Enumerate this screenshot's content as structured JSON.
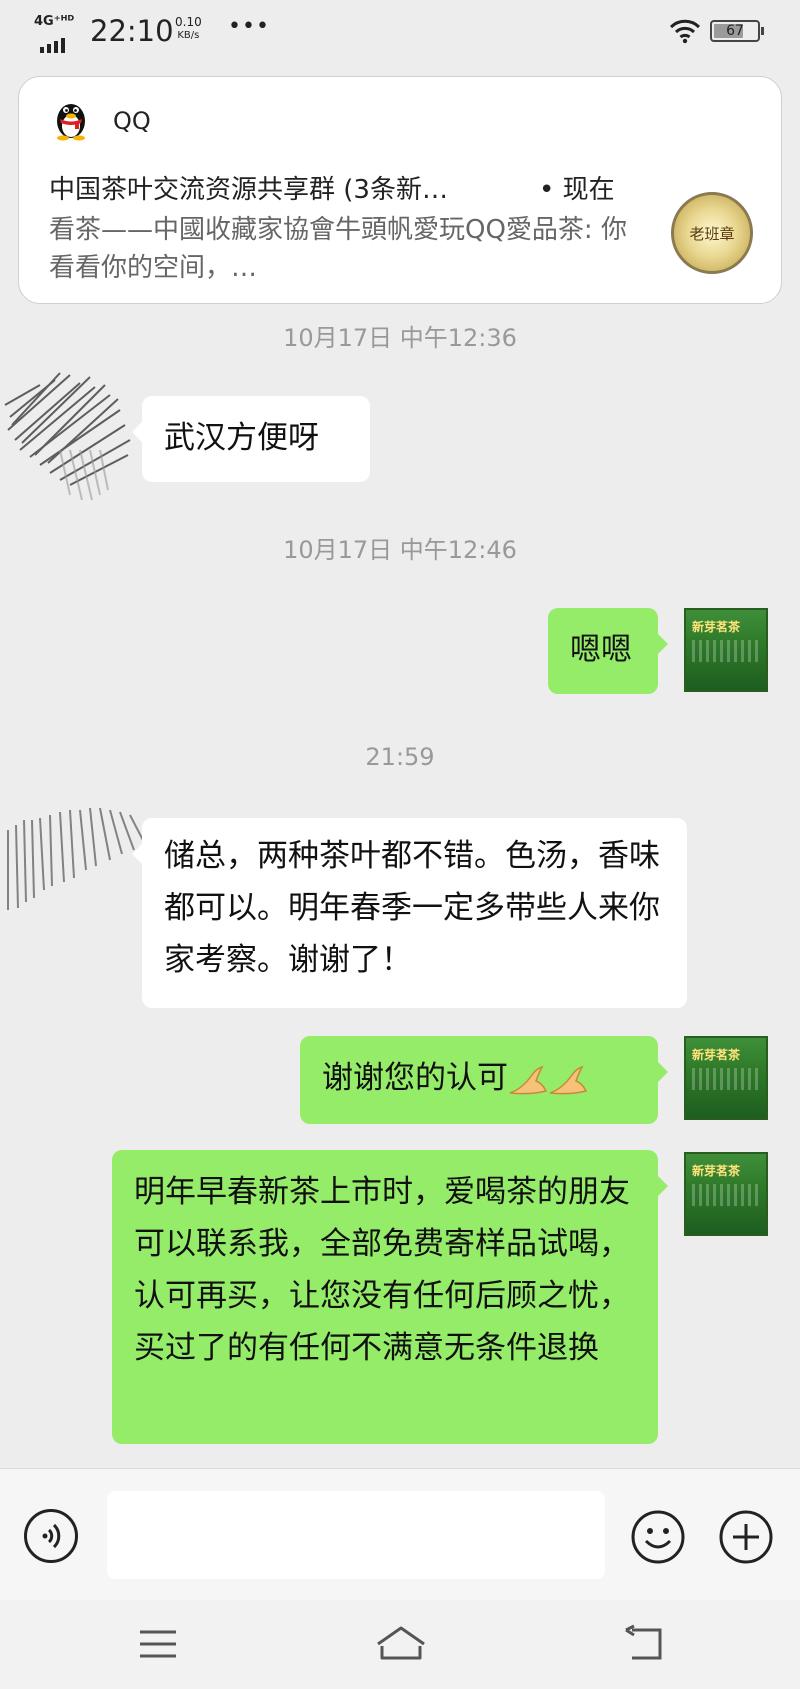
{
  "status_bar": {
    "network": "4G⁺ᴴᴰ",
    "time": "22:10",
    "speed_value": "0.10",
    "speed_unit": "KB/s",
    "more": "•••",
    "battery": "67"
  },
  "notification": {
    "app_name": "QQ",
    "title": "中国茶叶交流资源共享群 (3条新…",
    "time": "• 现在",
    "body": "看茶——中國收藏家協會牛頭帆愛玩QQ愛品茶: 你看看你的空间，…",
    "thumbnail_text": "老班章"
  },
  "chat": {
    "timestamps": [
      "10月17日 中午12:36",
      "10月17日 中午12:46",
      "21:59"
    ],
    "messages": [
      {
        "side": "left",
        "text": "武汉方便呀"
      },
      {
        "side": "right",
        "text": "嗯嗯"
      },
      {
        "side": "left",
        "text": "储总，两种茶叶都不错。色汤，香味都可以。明年春季一定多带些人来你家考察。谢谢了！"
      },
      {
        "side": "right",
        "text": "谢谢您的认可"
      },
      {
        "side": "right",
        "text": "明年早春新茶上市时，爱喝茶的朋友可以联系我，全部免费寄样品试喝，认可再买，让您没有任何后顾之忧，买过了的有任何不满意无条件退换"
      }
    ],
    "self_avatar_label": "新芽茗茶"
  },
  "input_bar": {
    "placeholder": ""
  },
  "colors": {
    "background": "#ededed",
    "self_bubble": "#95ec69",
    "other_bubble": "#ffffff",
    "timestamp": "#999999"
  },
  "icons": {
    "voice": "voice-icon",
    "emoji": "emoji-icon",
    "plus": "plus-icon",
    "menu": "menu-icon",
    "home": "home-icon",
    "back": "back-icon"
  }
}
